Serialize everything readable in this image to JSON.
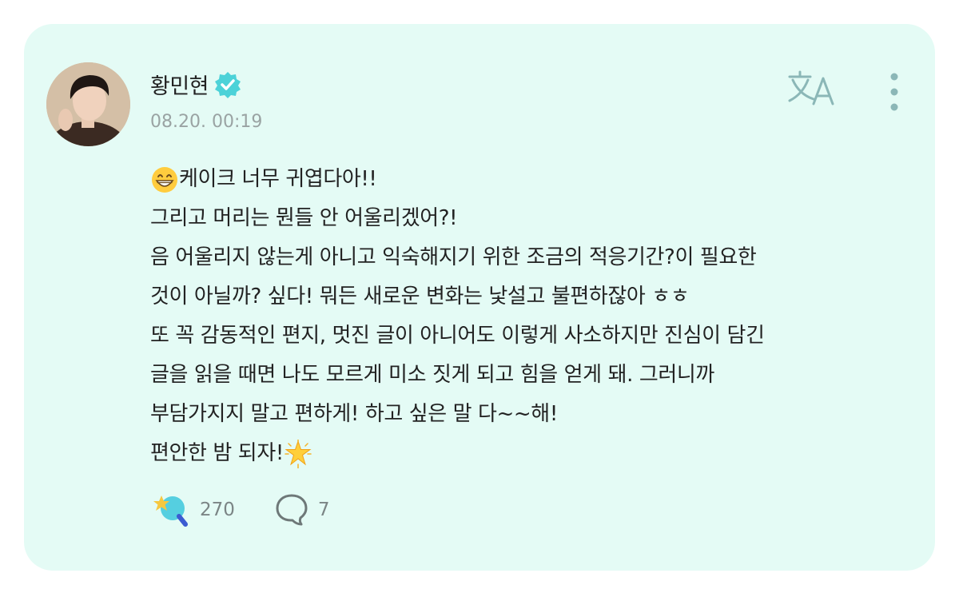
{
  "post": {
    "author": "황민현",
    "verified": true,
    "timestamp": "08.20. 00:19",
    "body_lines": [
      "케이크 너무 귀엽다아!!",
      "그리고 머리는 뭔들 안 어울리겠어?!",
      "음 어울리지 않는게 아니고 익숙해지기 위한 조금의 적응기간?이 필요한",
      "것이 아닐까? 싶다! 뭐든 새로운 변화는 낯설고 불편하잖아 ㅎㅎ",
      "또 꼭 감동적인 편지, 멋진 글이 아니어도 이렇게 사소하지만 진심이 담긴",
      "글을 읽을 때면 나도 모르게 미소 짓게 되고 힘을 얻게 돼. 그러니까",
      "부담가지지 말고 편하게! 하고 싶은 말 다~~해!",
      "편안한 밤 되자!"
    ],
    "emojis": {
      "leading": "grinning-face-emoji",
      "trailing": "glowing-star-emoji"
    }
  },
  "actions": {
    "reactions_count": "270",
    "comments_count": "7",
    "translate_icon": "translate-icon",
    "more_icon": "more-vertical-icon"
  },
  "colors": {
    "card_background": "#e4fbf5",
    "accent": "#4cd2d8",
    "text": "#222222",
    "muted": "#9aa3a3"
  }
}
